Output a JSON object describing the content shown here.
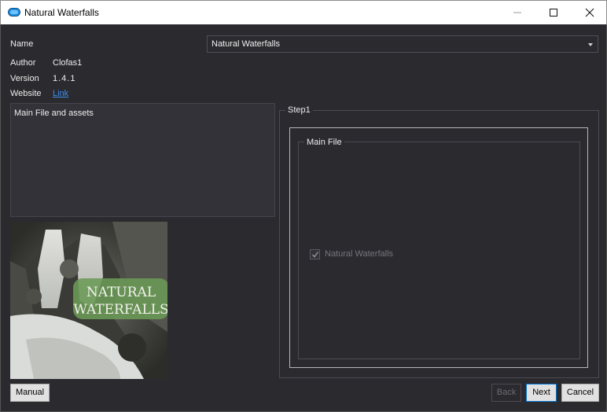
{
  "window": {
    "title": "Natural Waterfalls",
    "icon": "app-cloud-icon",
    "controls": [
      "minimize-icon",
      "maximize-icon",
      "close-icon"
    ]
  },
  "info": {
    "name_label": "Name",
    "name_value": "Natural Waterfalls",
    "author_label": "Author",
    "author_value": "Clofas1",
    "version_label": "Version",
    "version_value": "1.4.1",
    "website_label": "Website",
    "website_link_text": "Link"
  },
  "description": "Main File and assets",
  "preview": {
    "caption_line1": "NATURAL",
    "caption_line2": "WATERFALLS"
  },
  "step": {
    "title": "Step1",
    "group_title": "Main File",
    "options": [
      {
        "label": "Natural Waterfalls",
        "checked": true,
        "disabled": true
      }
    ]
  },
  "buttons": {
    "manual": "Manual",
    "back": "Back",
    "next": "Next",
    "cancel": "Cancel"
  },
  "colors": {
    "background": "#2b2a2f",
    "link": "#3b8ff0",
    "accent": "#0078d7"
  }
}
